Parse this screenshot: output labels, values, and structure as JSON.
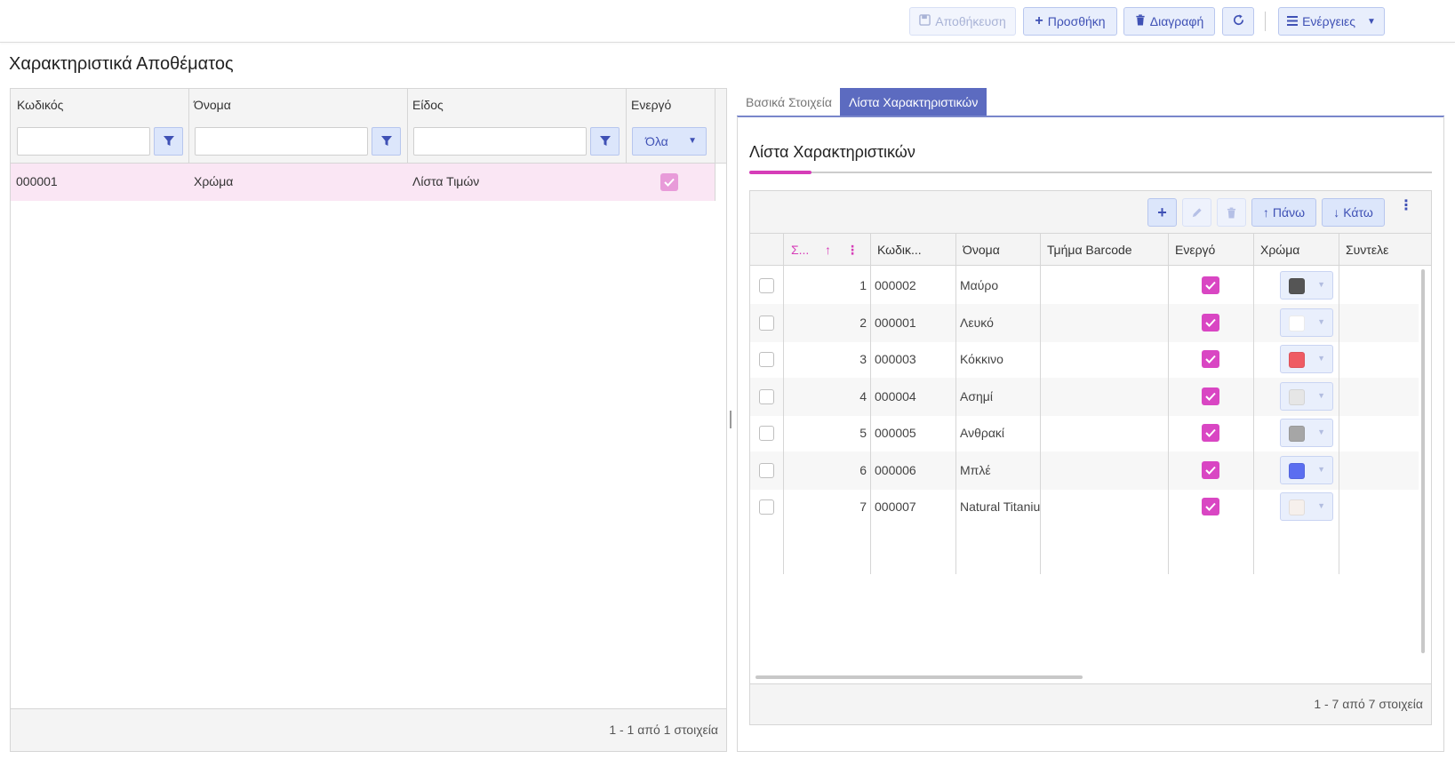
{
  "toolbar": {
    "save_label": "Αποθήκευση",
    "add_label": "Προσθήκη",
    "delete_label": "Διαγραφή",
    "actions_label": "Ενέργειες"
  },
  "page_title": "Χαρακτηριστικά Αποθέματος",
  "left_grid": {
    "columns": [
      "Κωδικός",
      "Όνομα",
      "Είδος",
      "Ενεργό"
    ],
    "active_filter_value": "Όλα",
    "rows": [
      {
        "code": "000001",
        "name": "Χρώμα",
        "type": "Λίστα Τιμών",
        "active": true
      }
    ],
    "footer": "1 - 1 από 1 στοιχεία"
  },
  "tabs": [
    {
      "label": "Βασικά Στοιχεία",
      "active": false
    },
    {
      "label": "Λίστα Χαρακτηριστικών",
      "active": true
    }
  ],
  "right_panel": {
    "title": "Λίστα Χαρακτηριστικών",
    "up_label": "Πάνω",
    "down_label": "Κάτω",
    "columns": [
      "Σ...",
      "Κωδικ...",
      "Όνομα",
      "Τμήμα Barcode",
      "Ενεργό",
      "Χρώμα",
      "Συντελε"
    ],
    "rows": [
      {
        "seq": "1",
        "code": "000002",
        "name": "Μαύρο",
        "barcode": "",
        "active": true,
        "color": "#555555"
      },
      {
        "seq": "2",
        "code": "000001",
        "name": "Λευκό",
        "barcode": "",
        "active": true,
        "color": "#ffffff"
      },
      {
        "seq": "3",
        "code": "000003",
        "name": "Κόκκινο",
        "barcode": "",
        "active": true,
        "color": "#ef5b63"
      },
      {
        "seq": "4",
        "code": "000004",
        "name": "Ασημί",
        "barcode": "",
        "active": true,
        "color": "#e6e6e6"
      },
      {
        "seq": "5",
        "code": "000005",
        "name": "Ανθρακί",
        "barcode": "",
        "active": true,
        "color": "#a6a6a6"
      },
      {
        "seq": "6",
        "code": "000006",
        "name": "Μπλέ",
        "barcode": "",
        "active": true,
        "color": "#5b6ef0"
      },
      {
        "seq": "7",
        "code": "000007",
        "name": "Natural Titanium",
        "barcode": "",
        "active": true,
        "color": "#f6f0ec"
      }
    ],
    "footer": "1 - 7 από 7 στοιχεία"
  },
  "colors": {
    "accent": "#3f51b5",
    "pink": "#d946c3",
    "tab_active": "#5c6bc0"
  }
}
